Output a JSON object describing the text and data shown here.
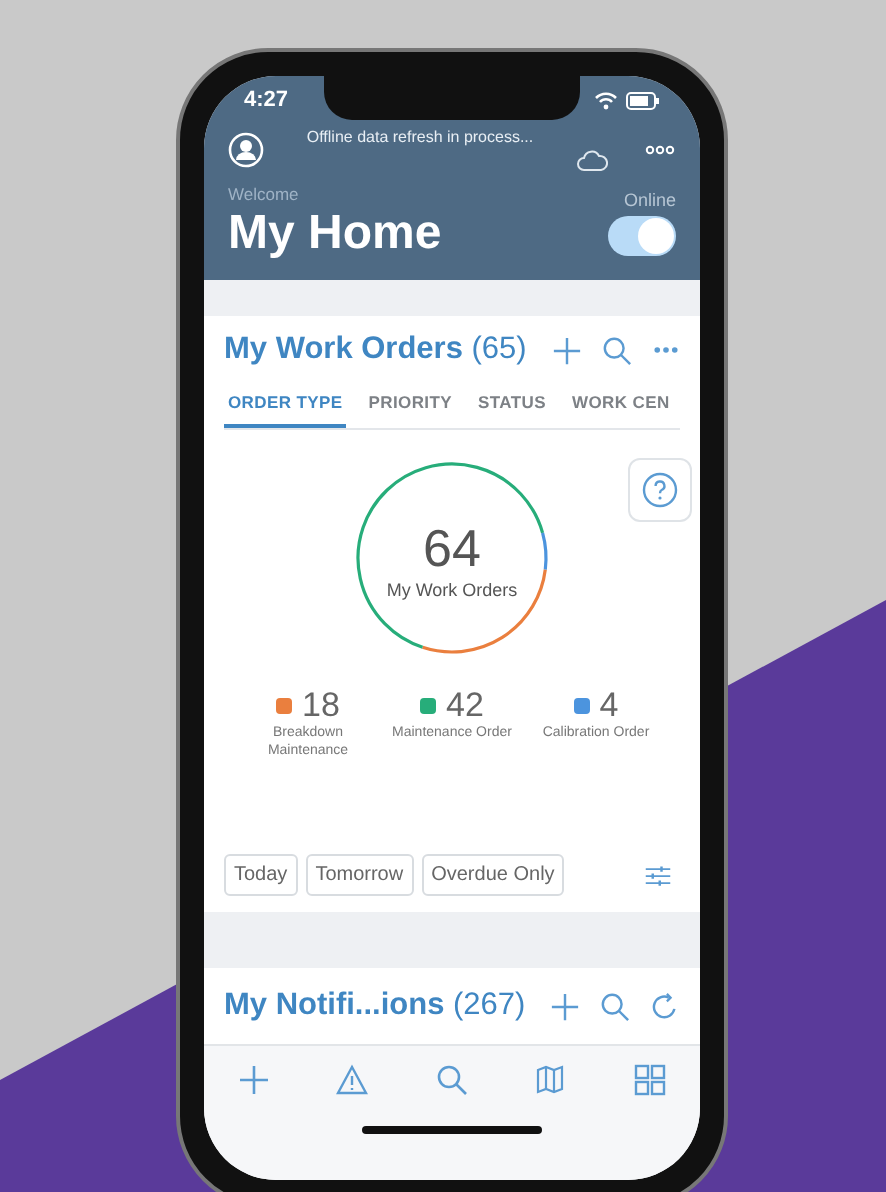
{
  "status_bar": {
    "time": "4:27"
  },
  "header": {
    "sync_message": "Offline data refresh in process...",
    "welcome": "Welcome",
    "title": "My Home",
    "online_label": "Online",
    "online": true
  },
  "work_orders": {
    "title": "My Work Orders",
    "count": "(65)",
    "tabs": [
      {
        "label": "ORDER TYPE",
        "selected": true
      },
      {
        "label": "PRIORITY",
        "selected": false
      },
      {
        "label": "STATUS",
        "selected": false
      },
      {
        "label": "WORK CEN",
        "selected": false
      }
    ],
    "total": "64",
    "total_label": "My Work Orders",
    "legend": [
      {
        "value": "18",
        "label": "Breakdown Maintenance",
        "color": "#ea7f3e"
      },
      {
        "value": "42",
        "label": "Maintenance Order",
        "color": "#27ad7a"
      },
      {
        "value": "4",
        "label": "Calibration Order",
        "color": "#4c94de"
      }
    ],
    "filters": [
      "Today",
      "Tomorrow",
      "Overdue Only"
    ]
  },
  "notifications": {
    "title": "My Notifi...ions",
    "count": "(267)"
  }
}
